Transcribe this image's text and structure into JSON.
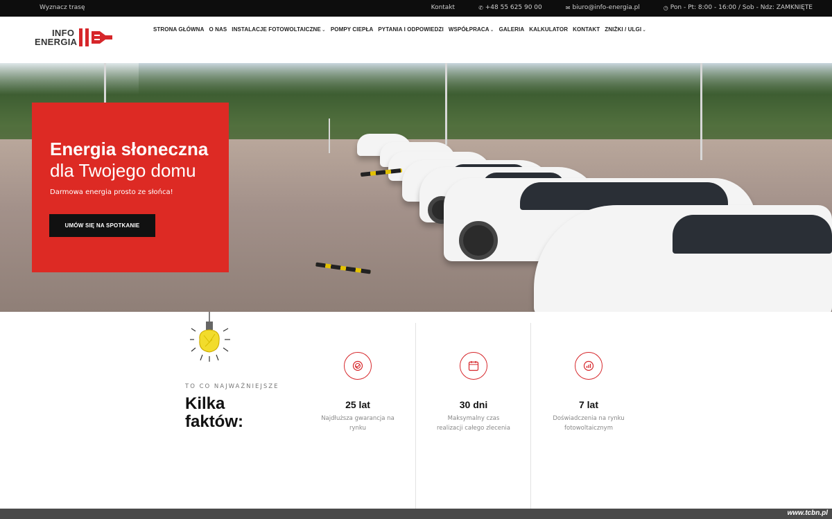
{
  "topbar": {
    "route_label": "Wyznacz trasę",
    "contact_label": "Kontakt",
    "phone": "+48 55 625 90 00",
    "email": "biuro@info-energia.pl",
    "hours": "Pon - Pt: 8:00 - 16:00 / Sob - Ndz: ZAMKNIĘTE"
  },
  "logo": {
    "line1": "INFO",
    "line2": "ENERGIA"
  },
  "nav": {
    "items": [
      {
        "label": "STRONA GŁÓWNA",
        "active": true
      },
      {
        "label": "O NAS"
      },
      {
        "label": "INSTALACJE FOTOWOLTAICZNE",
        "dropdown": true
      },
      {
        "label": "POMPY CIEPŁA"
      },
      {
        "label": "PYTANIA I ODPOWIEDZI"
      },
      {
        "label": "WSPÓŁPRACA",
        "dropdown": true
      },
      {
        "label": "GALERIA"
      },
      {
        "label": "KALKULATOR"
      },
      {
        "label": "KONTAKT"
      },
      {
        "label": "ZNIŻKI / ULGI",
        "dropdown": true
      }
    ]
  },
  "hero": {
    "title_bold": "Energia słoneczna",
    "title_regular": "dla Twojego domu",
    "subtitle": "Darmowa energia prosto ze słońca!",
    "cta": "UMÓW SIĘ NA SPOTKANIE"
  },
  "facts": {
    "eyebrow": "TO CO NAJWAŻNIEJSZE",
    "title_line1": "Kilka",
    "title_line2": "faktów:",
    "items": [
      {
        "value": "25 lat",
        "desc": "Najdłuższa gwarancja na rynku",
        "icon": "badge-check-icon"
      },
      {
        "value": "30 dni",
        "desc": "Maksymalny czas realizacji całego zlecenia",
        "icon": "calendar-icon"
      },
      {
        "value": "7 lat",
        "desc": "Doświadczenia na rynku fotowoltaicznym",
        "icon": "chart-icon"
      }
    ]
  },
  "watermark": "www.tcbn.pl",
  "colors": {
    "accent": "#d6262a",
    "hero_box": "#dd2a24",
    "topbar": "#0d0d0d"
  }
}
